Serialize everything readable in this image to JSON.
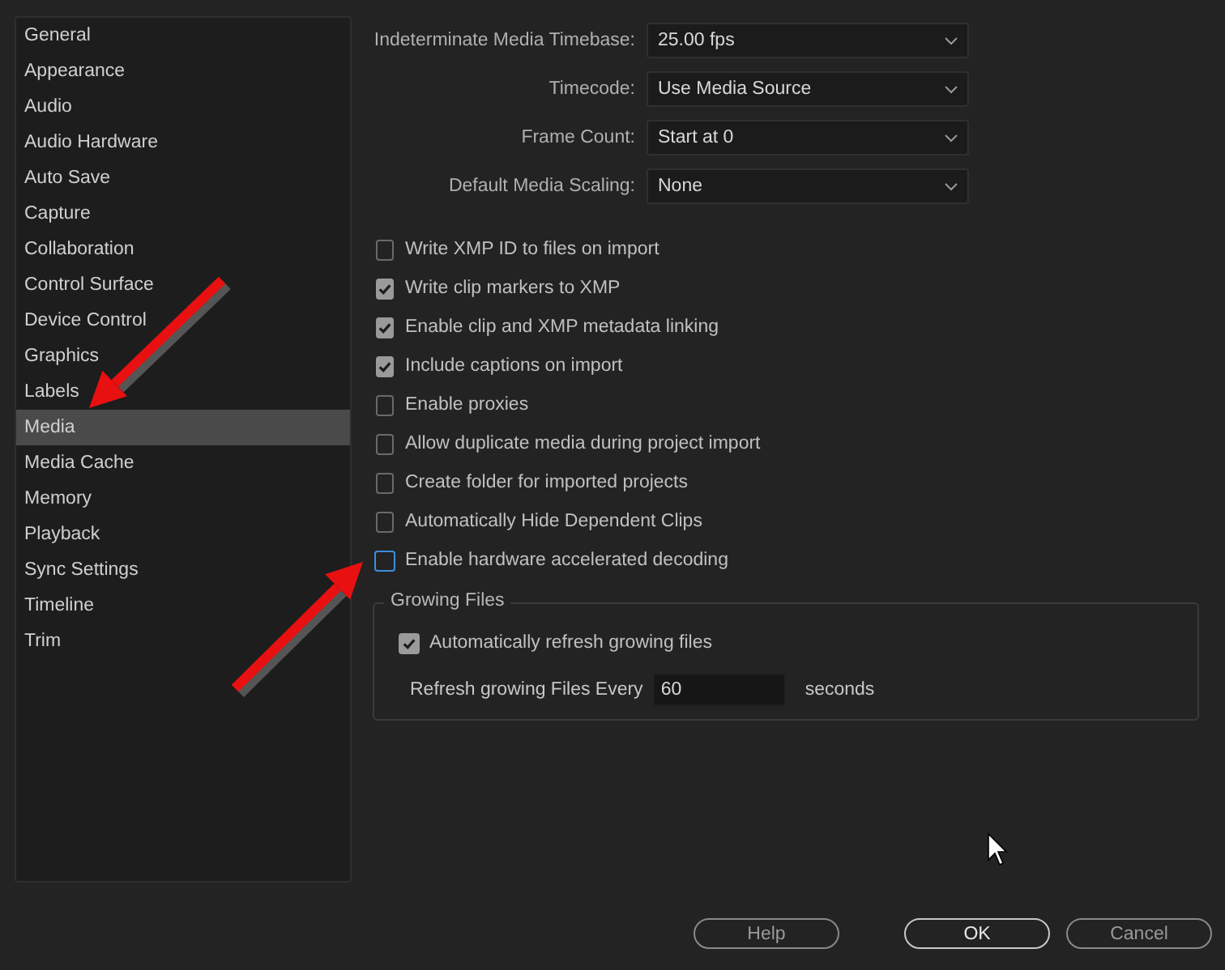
{
  "sidebar": {
    "items": [
      {
        "label": "General",
        "selected": false
      },
      {
        "label": "Appearance",
        "selected": false
      },
      {
        "label": "Audio",
        "selected": false
      },
      {
        "label": "Audio Hardware",
        "selected": false
      },
      {
        "label": "Auto Save",
        "selected": false
      },
      {
        "label": "Capture",
        "selected": false
      },
      {
        "label": "Collaboration",
        "selected": false
      },
      {
        "label": "Control Surface",
        "selected": false
      },
      {
        "label": "Device Control",
        "selected": false
      },
      {
        "label": "Graphics",
        "selected": false
      },
      {
        "label": "Labels",
        "selected": false
      },
      {
        "label": "Media",
        "selected": true
      },
      {
        "label": "Media Cache",
        "selected": false
      },
      {
        "label": "Memory",
        "selected": false
      },
      {
        "label": "Playback",
        "selected": false
      },
      {
        "label": "Sync Settings",
        "selected": false
      },
      {
        "label": "Timeline",
        "selected": false
      },
      {
        "label": "Trim",
        "selected": false
      }
    ]
  },
  "dropdowns": [
    {
      "label": "Indeterminate Media Timebase:",
      "value": "25.00 fps"
    },
    {
      "label": "Timecode:",
      "value": "Use Media Source"
    },
    {
      "label": "Frame Count:",
      "value": "Start at 0"
    },
    {
      "label": "Default Media Scaling:",
      "value": "None"
    }
  ],
  "checkboxes": [
    {
      "label": "Write XMP ID to files on import",
      "checked": false,
      "focused": false
    },
    {
      "label": "Write clip markers to XMP",
      "checked": true,
      "focused": false
    },
    {
      "label": "Enable clip and XMP metadata linking",
      "checked": true,
      "focused": false
    },
    {
      "label": "Include captions on import",
      "checked": true,
      "focused": false
    },
    {
      "label": "Enable proxies",
      "checked": false,
      "focused": false
    },
    {
      "label": "Allow duplicate media during project import",
      "checked": false,
      "focused": false
    },
    {
      "label": "Create folder for imported projects",
      "checked": false,
      "focused": false
    },
    {
      "label": "Automatically Hide Dependent Clips",
      "checked": false,
      "focused": false
    },
    {
      "label": "Enable hardware accelerated decoding",
      "checked": false,
      "focused": true
    }
  ],
  "growing_files": {
    "title": "Growing Files",
    "checkbox": {
      "label": "Automatically refresh growing files",
      "checked": true
    },
    "refresh": {
      "label": "Refresh growing Files Every",
      "value": "60",
      "unit": "seconds"
    }
  },
  "buttons": [
    {
      "label": "Help",
      "primary": false
    },
    {
      "label": "OK",
      "primary": true
    },
    {
      "label": "Cancel",
      "primary": false
    }
  ]
}
